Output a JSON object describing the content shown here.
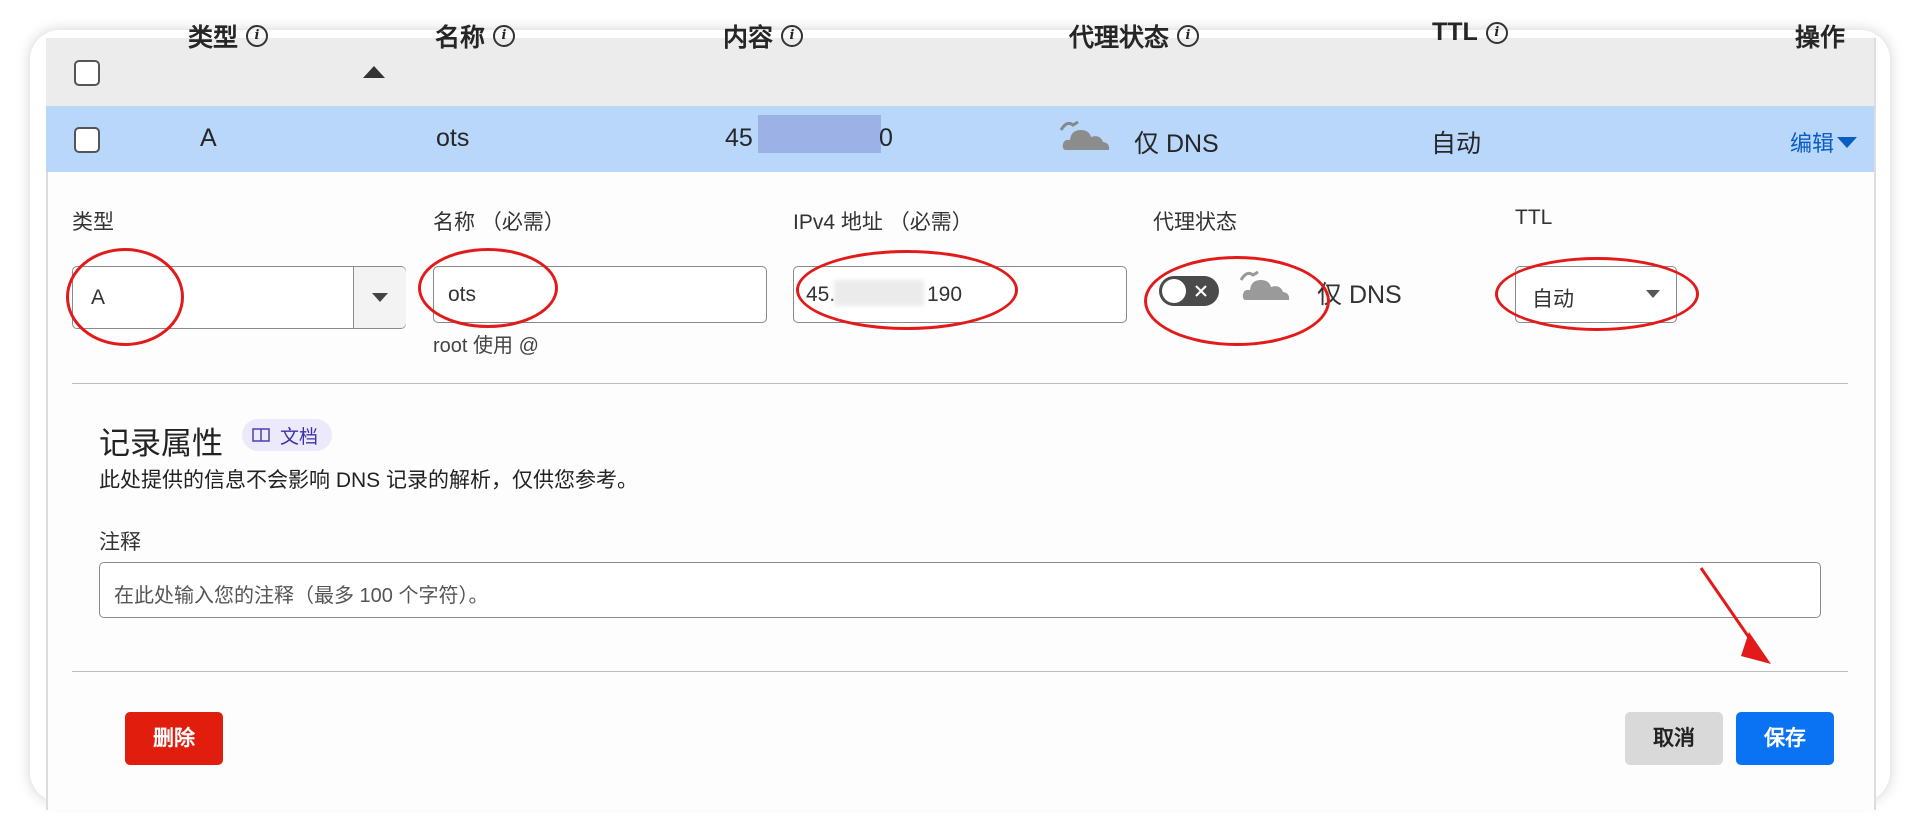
{
  "table": {
    "headers": {
      "type": "类型",
      "name": "名称",
      "content": "内容",
      "proxy": "代理状态",
      "ttl": "TTL",
      "actions": "操作"
    },
    "row": {
      "type": "A",
      "name": "ots",
      "content_prefix": "45",
      "content_suffix": "0",
      "proxy": "仅 DNS",
      "ttl": "自动",
      "edit": "编辑"
    }
  },
  "form": {
    "type_label": "类型",
    "type_value": "A",
    "name_label": "名称 （必需）",
    "name_value": "ots",
    "name_hint": "root 使用 @",
    "ip_label": "IPv4 地址 （必需）",
    "ip_value_prefix": "45.",
    "ip_value_suffix": "190",
    "proxy_label": "代理状态",
    "proxy_value": "仅 DNS",
    "ttl_label": "TTL",
    "ttl_value": "自动"
  },
  "record_attributes": {
    "title": "记录属性",
    "docs_label": "文档",
    "description": "此处提供的信息不会影响 DNS 记录的解析，仅供您参考。",
    "comment_label": "注释",
    "comment_placeholder": "在此处输入您的注释（最多 100 个字符）。"
  },
  "buttons": {
    "delete": "删除",
    "cancel": "取消",
    "save": "保存"
  },
  "colors": {
    "accent": "#0a73f4",
    "danger": "#e11d0e",
    "row_highlight": "#b9d7fb",
    "annotation_red": "#e21a1a"
  }
}
